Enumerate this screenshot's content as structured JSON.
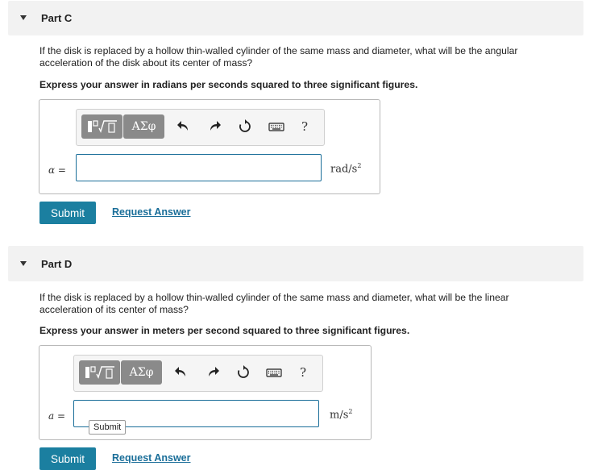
{
  "parts": [
    {
      "title": "Part C",
      "prompt": "If the disk is replaced by a hollow thin-walled cylinder of the same mass and diameter, what will be the angular acceleration of the disk about its center of mass?",
      "instruction": "Express your answer in radians per seconds squared to three significant figures.",
      "variable": "α =",
      "input_value": "",
      "unit_base": "rad/s",
      "unit_exp": "2",
      "submit_label": "Submit",
      "request_label": "Request Answer"
    },
    {
      "title": "Part D",
      "prompt": "If the disk is replaced by a hollow thin-walled cylinder of the same mass and diameter, what will be the linear acceleration of its center of mass?",
      "instruction": "Express your answer in meters per second squared to three significant figures.",
      "variable": "a =",
      "input_value": "",
      "unit_base": "m/s",
      "unit_exp": "2",
      "submit_label": "Submit",
      "request_label": "Request Answer",
      "tooltip": "Submit"
    }
  ],
  "toolbar": {
    "greek_label": "ΑΣφ",
    "help_label": "?",
    "icons": [
      "template-icon",
      "undo-icon",
      "redo-icon",
      "reset-icon",
      "keyboard-icon",
      "help-icon"
    ]
  },
  "colors": {
    "accent": "#1b7fa0",
    "link": "#1a6e99",
    "header_bg": "#f2f2f2",
    "toolbar_button": "#8a8a8a"
  }
}
